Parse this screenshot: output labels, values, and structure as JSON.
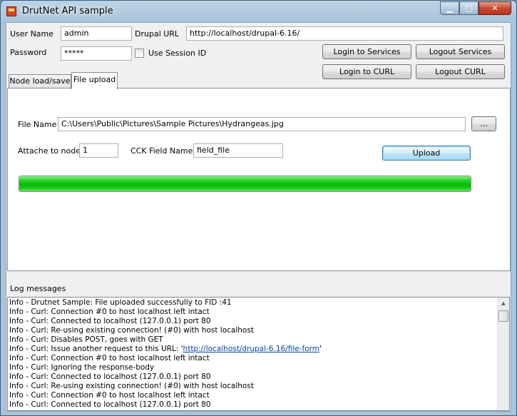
{
  "window": {
    "title": "DrutNet API sample"
  },
  "form": {
    "username_label": "User Name",
    "username_value": "admin",
    "drupal_url_label": "Drupal URL",
    "drupal_url_value": "http://localhost/drupal-6.16/",
    "password_label": "Password",
    "password_value": "*****",
    "use_session_label": "Use Session ID",
    "use_session_checked": false,
    "login_services_label": "Login to Services",
    "logout_services_label": "Logout Services",
    "login_curl_label": "Login to CURL",
    "logout_curl_label": "Logout CURL"
  },
  "tabs": [
    {
      "label": "Node load/save",
      "active": false
    },
    {
      "label": "File upload",
      "active": true
    }
  ],
  "upload": {
    "file_name_label": "File Name",
    "file_name_value": "C:\\Users\\Public\\Pictures\\Sample Pictures\\Hydrangeas.jpg",
    "browse_label": "...",
    "attach_label": "Attache to node",
    "attach_value": "1",
    "cck_label": "CCK Field Name",
    "cck_value": "field_file",
    "upload_label": "Upload",
    "progress_percent": 100
  },
  "log": {
    "label": "Log messages",
    "lines": [
      "Info - Drutnet Sample: File uploaded successfully to FID :41",
      "Info - Curl: Connection #0 to host localhost left intact",
      "Info - Curl: Connected to localhost (127.0.0.1) port 80",
      "Info - Curl: Re-using existing connection! (#0) with host localhost",
      "Info - Curl: Disables POST, goes with GET",
      "Info - Curl: Issue another request to this URL: 'http://localhost/drupal-6.16/file-form'",
      "Info - Curl: Connection #0 to host localhost left intact",
      "Info - Curl: Ignoring the response-body",
      "Info - Curl: Connected to localhost (127.0.0.1) port 80",
      "Info - Curl: Re-using existing connection! (#0) with host localhost",
      "Info - Curl: Connection #0 to host localhost left intact",
      "Info - Curl: Connected to localhost (127.0.0.1) port 80"
    ]
  },
  "icons": {
    "minimize": "minimize-icon",
    "maximize": "maximize-icon",
    "close": "close-icon"
  }
}
